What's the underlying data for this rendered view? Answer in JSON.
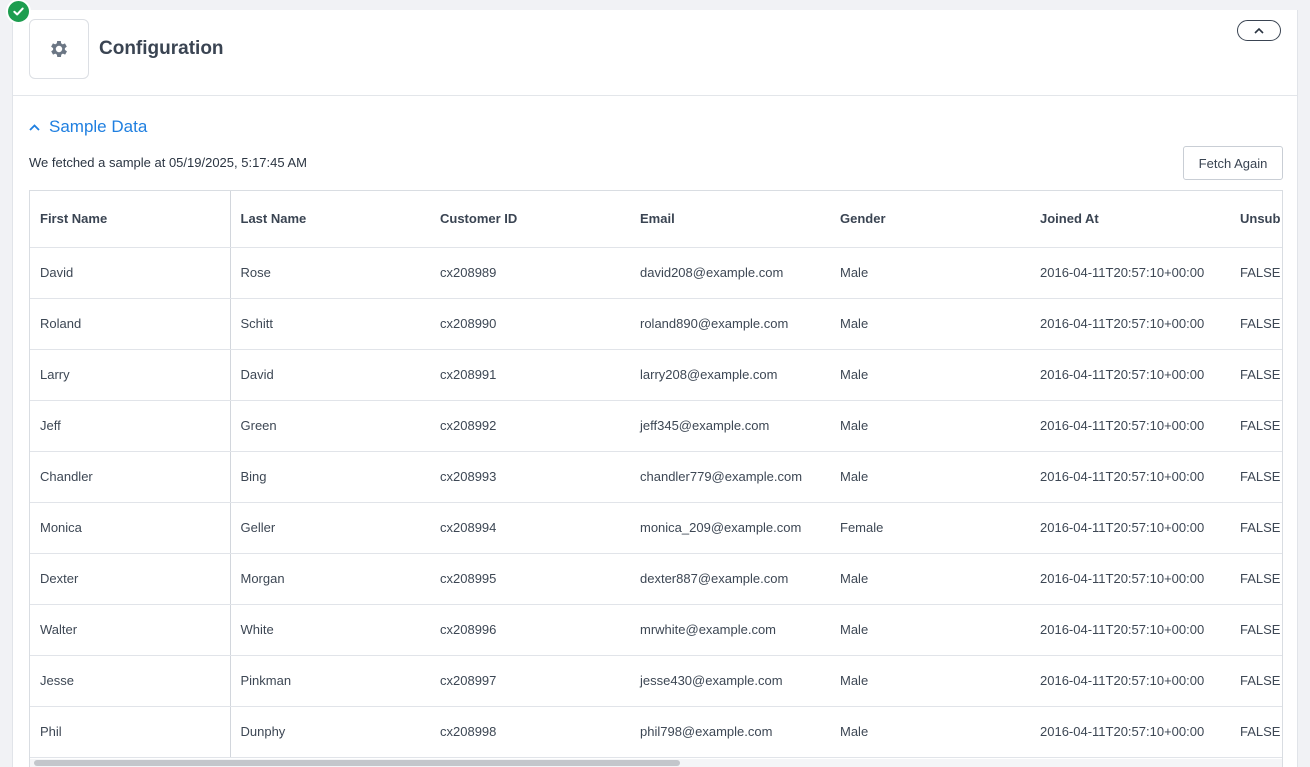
{
  "header": {
    "title": "Configuration",
    "icon": "gear-icon",
    "status_icon": "check-circle-icon",
    "status_color": "#1d9d4f"
  },
  "section": {
    "title": "Sample Data",
    "accent": "#1f7fe0"
  },
  "sample": {
    "fetched_text": "We fetched a sample at 05/19/2025, 5:17:45 AM",
    "fetch_again_label": "Fetch Again"
  },
  "table": {
    "columns": [
      "First Name",
      "Last Name",
      "Customer ID",
      "Email",
      "Gender",
      "Joined At",
      "Unsub"
    ],
    "rows": [
      [
        "David",
        "Rose",
        "cx208989",
        "david208@example.com",
        "Male",
        "2016-04-11T20:57:10+00:00",
        "FALSE"
      ],
      [
        "Roland",
        "Schitt",
        "cx208990",
        "roland890@example.com",
        "Male",
        "2016-04-11T20:57:10+00:00",
        "FALSE"
      ],
      [
        "Larry",
        "David",
        "cx208991",
        "larry208@example.com",
        "Male",
        "2016-04-11T20:57:10+00:00",
        "FALSE"
      ],
      [
        "Jeff",
        "Green",
        "cx208992",
        "jeff345@example.com",
        "Male",
        "2016-04-11T20:57:10+00:00",
        "FALSE"
      ],
      [
        "Chandler",
        "Bing",
        "cx208993",
        "chandler779@example.com",
        "Male",
        "2016-04-11T20:57:10+00:00",
        "FALSE"
      ],
      [
        "Monica",
        "Geller",
        "cx208994",
        "monica_209@example.com",
        "Female",
        "2016-04-11T20:57:10+00:00",
        "FALSE"
      ],
      [
        "Dexter",
        "Morgan",
        "cx208995",
        "dexter887@example.com",
        "Male",
        "2016-04-11T20:57:10+00:00",
        "FALSE"
      ],
      [
        "Walter",
        "White",
        "cx208996",
        "mrwhite@example.com",
        "Male",
        "2016-04-11T20:57:10+00:00",
        "FALSE"
      ],
      [
        "Jesse",
        "Pinkman",
        "cx208997",
        "jesse430@example.com",
        "Male",
        "2016-04-11T20:57:10+00:00",
        "FALSE"
      ],
      [
        "Phil",
        "Dunphy",
        "cx208998",
        "phil798@example.com",
        "Male",
        "2016-04-11T20:57:10+00:00",
        "FALSE"
      ]
    ]
  }
}
